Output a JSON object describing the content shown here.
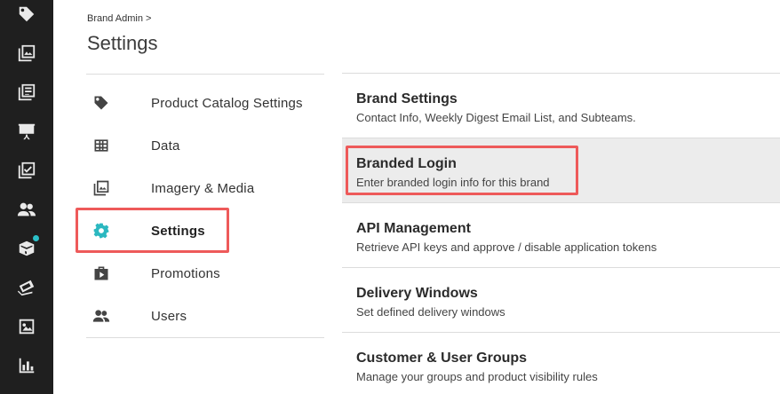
{
  "rail": {
    "icons": [
      "tag-icon",
      "gallery-icon",
      "catalog-icon",
      "presentation-icon",
      "checklist-icon",
      "users-icon",
      "box-icon",
      "promo-ticket-icon",
      "image-icon",
      "bar-chart-icon"
    ],
    "badge_color": "#2bc0c8"
  },
  "header": {
    "breadcrumb": "Brand Admin >",
    "title": "Settings"
  },
  "nav": {
    "items": [
      {
        "label": "Product Catalog Settings",
        "icon": "tag-icon"
      },
      {
        "label": "Data",
        "icon": "table-icon"
      },
      {
        "label": "Imagery & Media",
        "icon": "image-icon"
      },
      {
        "label": "Settings",
        "icon": "gear-icon",
        "active": true
      },
      {
        "label": "Promotions",
        "icon": "play-bag-icon"
      },
      {
        "label": "Users",
        "icon": "users-icon"
      }
    ],
    "active_color": "#2bb8c0"
  },
  "settings_list": [
    {
      "title": "Brand Settings",
      "subtitle": "Contact Info, Weekly Digest Email List, and Subteams."
    },
    {
      "title": "Branded Login",
      "subtitle": "Enter branded login info for this brand",
      "selected": true
    },
    {
      "title": "API Management",
      "subtitle": "Retrieve API keys and approve / disable application tokens"
    },
    {
      "title": "Delivery Windows",
      "subtitle": "Set defined delivery windows"
    },
    {
      "title": "Customer & User Groups",
      "subtitle": "Manage your groups and product visibility rules"
    }
  ],
  "highlight_color": "#ee5a5a"
}
